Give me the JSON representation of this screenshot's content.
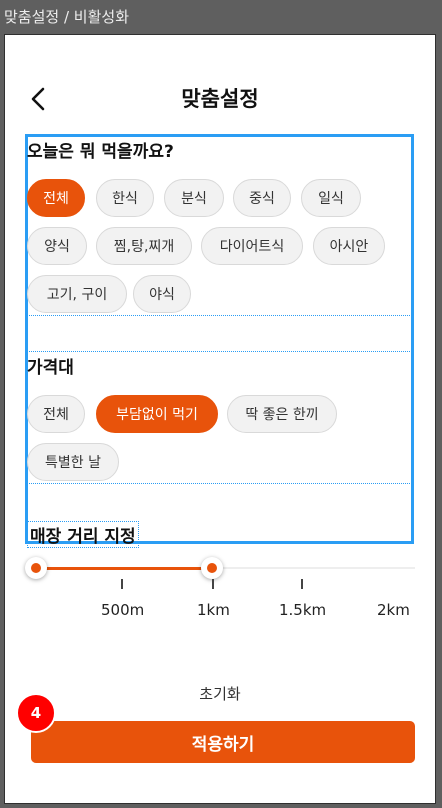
{
  "window": {
    "title": "맞춤설정 / 비활성화"
  },
  "header": {
    "title": "맞춤설정"
  },
  "food": {
    "title": "오늘은 뭐 먹을까요?",
    "chips": [
      "전체",
      "한식",
      "분식",
      "중식",
      "일식",
      "양식",
      "찜,탕,찌개",
      "다이어트식",
      "아시안",
      "고기, 구이",
      "야식"
    ],
    "selected": "전체"
  },
  "price": {
    "title": "가격대",
    "chips": [
      "전체",
      "부담없이 먹기",
      "딱 좋은 한끼",
      "특별한 날"
    ],
    "selected": "부담없이 먹기"
  },
  "distance": {
    "title": "매장 거리 지정",
    "labels": [
      "500m",
      "1km",
      "1.5km",
      "2km"
    ],
    "range_selected": [
      "0",
      "1km"
    ]
  },
  "footer": {
    "reset_label": "초기화",
    "apply_label": "적용하기"
  },
  "annotation": {
    "badge": "4"
  },
  "colors": {
    "accent": "#e8530b",
    "highlight": "#2a9df4",
    "badge": "#ff0000"
  }
}
